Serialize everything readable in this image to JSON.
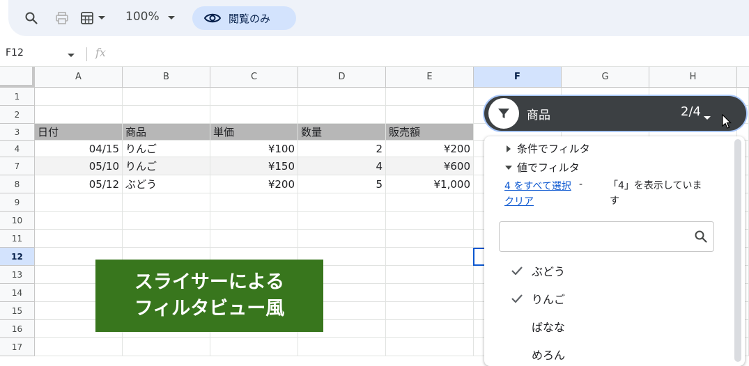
{
  "toolbar": {
    "zoom": "100%",
    "view_mode": "閲覧のみ",
    "icons": [
      "search-icon",
      "print-icon",
      "calculator-icon",
      "chevron-down-icon",
      "eye-icon"
    ]
  },
  "formula_bar": {
    "name_box": "F12",
    "fx_symbol": "fx"
  },
  "grid": {
    "columns": [
      "A",
      "B",
      "C",
      "D",
      "E",
      "F",
      "G",
      "H"
    ],
    "selected_column": "F",
    "rows": [
      "1",
      "2",
      "3",
      "4",
      "7",
      "8",
      "9",
      "10",
      "11",
      "12",
      "13",
      "14",
      "15",
      "16",
      "17"
    ],
    "selected_row": "12",
    "header_row": [
      "日付",
      "商品",
      "単価",
      "数量",
      "販売額"
    ],
    "data_rows": [
      [
        "04/15",
        "りんご",
        "¥100",
        "2",
        "¥200"
      ],
      [
        "05/10",
        "りんご",
        "¥150",
        "4",
        "¥600"
      ],
      [
        "05/12",
        "ぶどう",
        "¥200",
        "5",
        "¥1,000"
      ]
    ]
  },
  "banner": {
    "line1": "スライサーによる",
    "line2": "フィルタビュー風"
  },
  "slicer": {
    "label": "商品",
    "count": "2/4"
  },
  "filter_panel": {
    "condition_section": "条件でフィルタ",
    "value_section": "値でフィルタ",
    "select_all": "4 をすべて選択",
    "dash": "-",
    "clear": "クリア",
    "showing": "「4」を表示していま",
    "showing_2": "す",
    "search_placeholder": "",
    "items": [
      {
        "label": "ぶどう",
        "checked": true
      },
      {
        "label": "りんご",
        "checked": true
      },
      {
        "label": "ばなな",
        "checked": false
      },
      {
        "label": "めろん",
        "checked": false
      }
    ]
  },
  "colors": {
    "toolbar_bg": "#eef2f9",
    "view_pill": "#d3e3fd",
    "banner_bg": "#38761d",
    "chip_bg": "#3c4043",
    "header_fill": "#b7b7b7",
    "link": "#0b57d0"
  }
}
